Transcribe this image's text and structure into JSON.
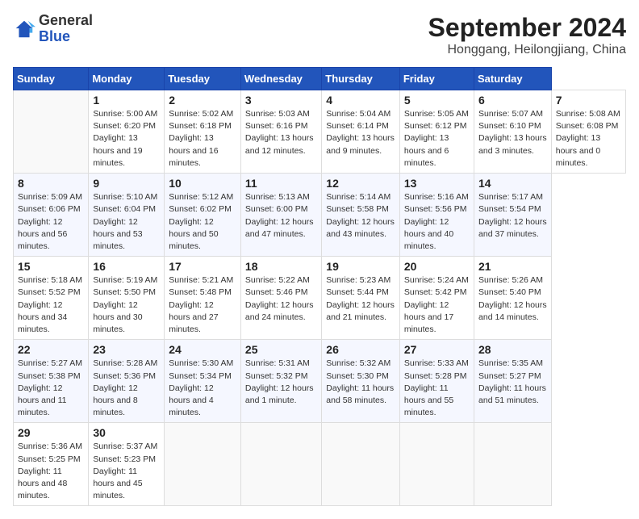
{
  "header": {
    "logo_general": "General",
    "logo_blue": "Blue",
    "month_title": "September 2024",
    "subtitle": "Honggang, Heilongjiang, China"
  },
  "calendar": {
    "weekdays": [
      "Sunday",
      "Monday",
      "Tuesday",
      "Wednesday",
      "Thursday",
      "Friday",
      "Saturday"
    ],
    "weeks": [
      [
        null,
        {
          "day": 1,
          "sunrise": "5:00 AM",
          "sunset": "6:20 PM",
          "daylight": "13 hours and 19 minutes."
        },
        {
          "day": 2,
          "sunrise": "5:02 AM",
          "sunset": "6:18 PM",
          "daylight": "13 hours and 16 minutes."
        },
        {
          "day": 3,
          "sunrise": "5:03 AM",
          "sunset": "6:16 PM",
          "daylight": "13 hours and 12 minutes."
        },
        {
          "day": 4,
          "sunrise": "5:04 AM",
          "sunset": "6:14 PM",
          "daylight": "13 hours and 9 minutes."
        },
        {
          "day": 5,
          "sunrise": "5:05 AM",
          "sunset": "6:12 PM",
          "daylight": "13 hours and 6 minutes."
        },
        {
          "day": 6,
          "sunrise": "5:07 AM",
          "sunset": "6:10 PM",
          "daylight": "13 hours and 3 minutes."
        },
        {
          "day": 7,
          "sunrise": "5:08 AM",
          "sunset": "6:08 PM",
          "daylight": "13 hours and 0 minutes."
        }
      ],
      [
        {
          "day": 8,
          "sunrise": "5:09 AM",
          "sunset": "6:06 PM",
          "daylight": "12 hours and 56 minutes."
        },
        {
          "day": 9,
          "sunrise": "5:10 AM",
          "sunset": "6:04 PM",
          "daylight": "12 hours and 53 minutes."
        },
        {
          "day": 10,
          "sunrise": "5:12 AM",
          "sunset": "6:02 PM",
          "daylight": "12 hours and 50 minutes."
        },
        {
          "day": 11,
          "sunrise": "5:13 AM",
          "sunset": "6:00 PM",
          "daylight": "12 hours and 47 minutes."
        },
        {
          "day": 12,
          "sunrise": "5:14 AM",
          "sunset": "5:58 PM",
          "daylight": "12 hours and 43 minutes."
        },
        {
          "day": 13,
          "sunrise": "5:16 AM",
          "sunset": "5:56 PM",
          "daylight": "12 hours and 40 minutes."
        },
        {
          "day": 14,
          "sunrise": "5:17 AM",
          "sunset": "5:54 PM",
          "daylight": "12 hours and 37 minutes."
        }
      ],
      [
        {
          "day": 15,
          "sunrise": "5:18 AM",
          "sunset": "5:52 PM",
          "daylight": "12 hours and 34 minutes."
        },
        {
          "day": 16,
          "sunrise": "5:19 AM",
          "sunset": "5:50 PM",
          "daylight": "12 hours and 30 minutes."
        },
        {
          "day": 17,
          "sunrise": "5:21 AM",
          "sunset": "5:48 PM",
          "daylight": "12 hours and 27 minutes."
        },
        {
          "day": 18,
          "sunrise": "5:22 AM",
          "sunset": "5:46 PM",
          "daylight": "12 hours and 24 minutes."
        },
        {
          "day": 19,
          "sunrise": "5:23 AM",
          "sunset": "5:44 PM",
          "daylight": "12 hours and 21 minutes."
        },
        {
          "day": 20,
          "sunrise": "5:24 AM",
          "sunset": "5:42 PM",
          "daylight": "12 hours and 17 minutes."
        },
        {
          "day": 21,
          "sunrise": "5:26 AM",
          "sunset": "5:40 PM",
          "daylight": "12 hours and 14 minutes."
        }
      ],
      [
        {
          "day": 22,
          "sunrise": "5:27 AM",
          "sunset": "5:38 PM",
          "daylight": "12 hours and 11 minutes."
        },
        {
          "day": 23,
          "sunrise": "5:28 AM",
          "sunset": "5:36 PM",
          "daylight": "12 hours and 8 minutes."
        },
        {
          "day": 24,
          "sunrise": "5:30 AM",
          "sunset": "5:34 PM",
          "daylight": "12 hours and 4 minutes."
        },
        {
          "day": 25,
          "sunrise": "5:31 AM",
          "sunset": "5:32 PM",
          "daylight": "12 hours and 1 minute."
        },
        {
          "day": 26,
          "sunrise": "5:32 AM",
          "sunset": "5:30 PM",
          "daylight": "11 hours and 58 minutes."
        },
        {
          "day": 27,
          "sunrise": "5:33 AM",
          "sunset": "5:28 PM",
          "daylight": "11 hours and 55 minutes."
        },
        {
          "day": 28,
          "sunrise": "5:35 AM",
          "sunset": "5:27 PM",
          "daylight": "11 hours and 51 minutes."
        }
      ],
      [
        {
          "day": 29,
          "sunrise": "5:36 AM",
          "sunset": "5:25 PM",
          "daylight": "11 hours and 48 minutes."
        },
        {
          "day": 30,
          "sunrise": "5:37 AM",
          "sunset": "5:23 PM",
          "daylight": "11 hours and 45 minutes."
        },
        null,
        null,
        null,
        null,
        null
      ]
    ]
  }
}
